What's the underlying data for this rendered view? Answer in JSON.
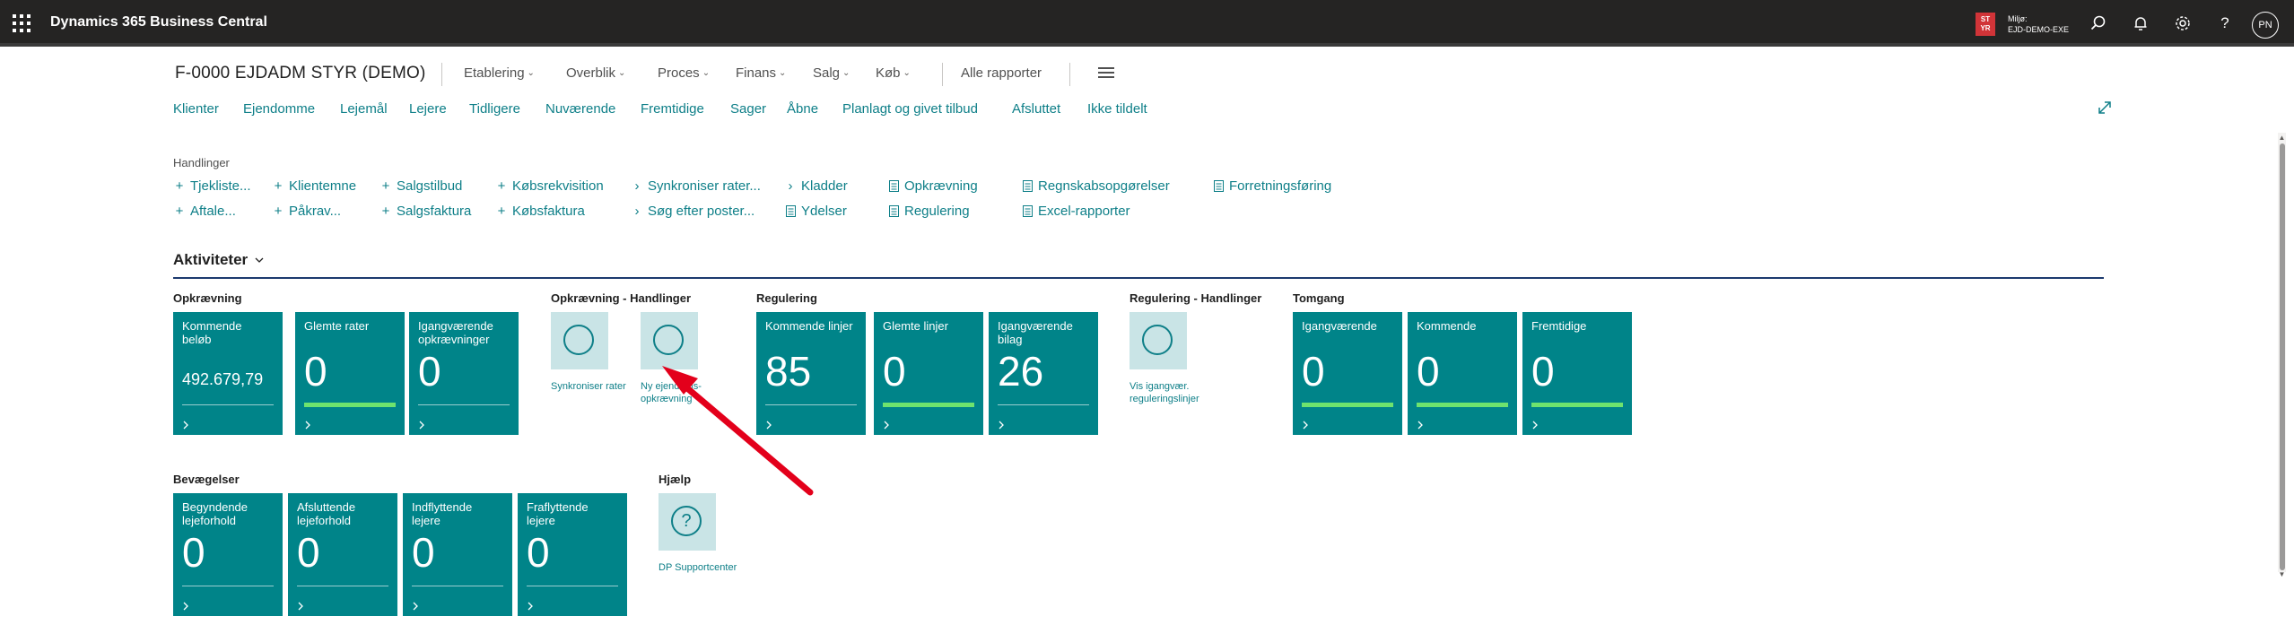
{
  "header": {
    "app_title": "Dynamics 365 Business Central",
    "environment_badge": "ST YR",
    "environment_label": "Miljø:",
    "environment_name": "EJD-DEMO-EXE",
    "user_initials": "PN",
    "icons": [
      "app-launcher-icon",
      "search-icon",
      "bell-icon",
      "gear-icon",
      "help-icon"
    ]
  },
  "page": {
    "company": "F-0000 EJDADM STYR (DEMO)",
    "menu": [
      "Etablering",
      "Overblik",
      "Proces",
      "Finans",
      "Salg",
      "Køb"
    ],
    "all_reports": "Alle rapporter",
    "nav_links": [
      "Klienter",
      "Ejendomme",
      "Lejemål",
      "Lejere",
      "Tidligere",
      "Nuværende",
      "Fremtidige",
      "Sager",
      "Åbne",
      "Planlagt og givet tilbud",
      "Afsluttet",
      "Ikke tildelt"
    ]
  },
  "actions": {
    "label": "Handlinger",
    "row1": [
      "Tjekliste...",
      "Klientemne",
      "Salgstilbud",
      "Købsrekvisition",
      "Synkroniser rater...",
      "Kladder",
      "Opkrævning",
      "Regnskabsopgørelser",
      "Forretningsføring"
    ],
    "row2": [
      "Aftale...",
      "Påkrav...",
      "Salgsfaktura",
      "Købsfaktura",
      "Søg efter poster...",
      "Ydelser",
      "Regulering",
      "Excel-rapporter"
    ]
  },
  "activities": {
    "title": "Aktiviteter",
    "groups": {
      "opkraevning": "Opkrævning",
      "opkraevning_handlinger": "Opkrævning - Handlinger",
      "regulering": "Regulering",
      "regulering_handlinger": "Regulering - Handlinger",
      "tomgang": "Tomgang",
      "bevaegelser": "Bevægelser",
      "hjaelp": "Hjælp"
    },
    "tiles": {
      "kommende_beloeb": {
        "title": "Kommende beløb",
        "value": "492.679,79"
      },
      "glemte_rater": {
        "title": "Glemte rater",
        "value": "0"
      },
      "igangvaerende_opkraevninger": {
        "title": "Igangværende opkrævninger",
        "value": "0"
      },
      "kommende_linjer": {
        "title": "Kommende linjer",
        "value": "85"
      },
      "glemte_linjer": {
        "title": "Glemte linjer",
        "value": "0"
      },
      "igangvaerende_bilag": {
        "title": "Igangværende bilag",
        "value": "26"
      },
      "tomgang_igangvaerende": {
        "title": "Igangværende",
        "value": "0"
      },
      "tomgang_kommende": {
        "title": "Kommende",
        "value": "0"
      },
      "tomgang_fremtidige": {
        "title": "Fremtidige",
        "value": "0"
      },
      "begyndende": {
        "title": "Begyndende lejeforhold",
        "value": "0"
      },
      "afsluttende": {
        "title": "Afsluttende lejeforhold",
        "value": "0"
      },
      "indflyttende": {
        "title": "Indflyttende lejere",
        "value": "0"
      },
      "fraflyttende": {
        "title": "Fraflyttende lejere",
        "value": "0"
      }
    },
    "action_tiles": {
      "synkroniser": "Synkroniser rater",
      "ny_opkraevning": "Ny ejendoms-opkrævning",
      "vis_regulering": "Vis igangvær. reguleringslinjer",
      "supportcenter": "DP Supportcenter"
    }
  },
  "colors": {
    "tile": "#008489",
    "link": "#0e7f88",
    "topbar": "#252423",
    "arrow": "#e3001b",
    "progress": "#6ee36e"
  }
}
